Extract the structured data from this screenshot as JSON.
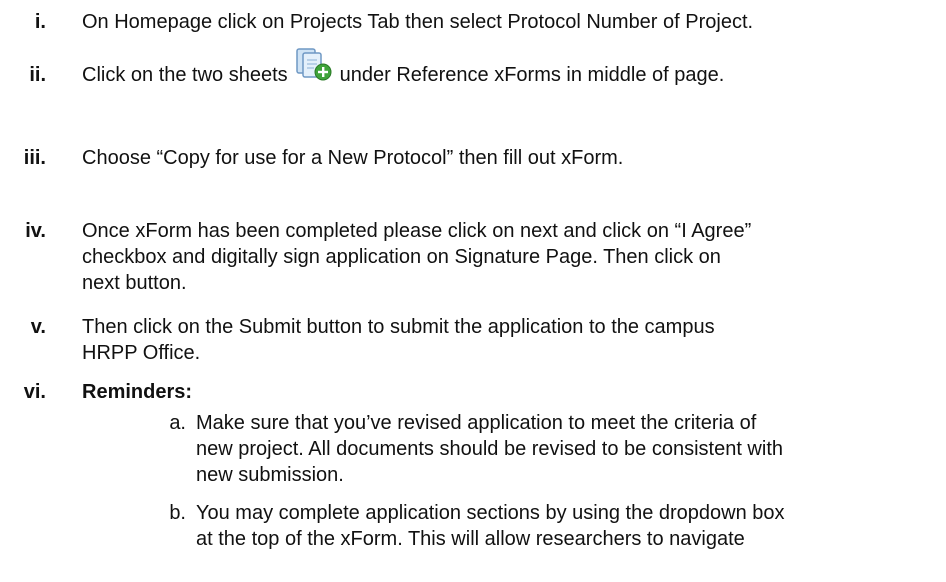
{
  "steps": [
    {
      "marker": "i.",
      "lines": [
        "On Homepage click on Projects Tab then select Protocol Number of Project."
      ]
    },
    {
      "marker": "ii.",
      "before_icon": "Click on the two sheets",
      "icon": "two-sheets-add-icon",
      "after_icon": "under Reference xForms in middle of page."
    },
    {
      "marker": "iii.",
      "lines": [
        "Choose “Copy for use for a New Protocol” then fill out xForm."
      ]
    },
    {
      "marker": "iv.",
      "lines": [
        "Once xForm has been completed please click on next and click on “I Agree”",
        "checkbox and digitally sign application on Signature Page. Then click on",
        "next button."
      ]
    },
    {
      "marker": "v.",
      "lines": [
        "Then click on the Submit button to submit the application to the campus",
        "HRPP Office."
      ]
    },
    {
      "marker": "vi.",
      "heading": "Reminders:"
    }
  ],
  "reminders": [
    {
      "marker": "a.",
      "lines": [
        "Make sure that you’ve revised application to meet the criteria of",
        "new project. All documents should be revised to be consistent with",
        "new submission."
      ]
    },
    {
      "marker": "b.",
      "lines": [
        "You may complete application sections by using the dropdown box",
        "at the top of the xForm. This will allow researchers to navigate"
      ]
    }
  ],
  "colors": {
    "text": "#111111",
    "icon_sheet": "#cfe3f5",
    "icon_sheet_border": "#6f98c4",
    "icon_plus": "#3fa33a"
  }
}
